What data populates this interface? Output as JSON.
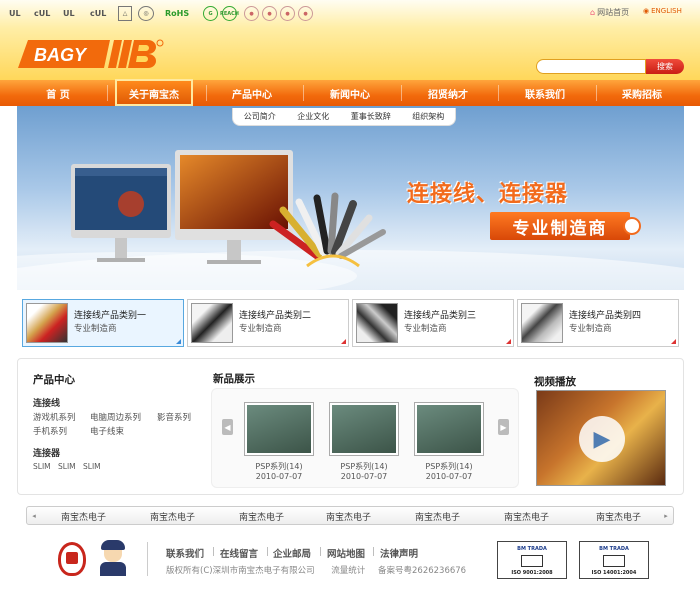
{
  "header": {
    "certifications": [
      "UL",
      "cUL",
      "UL",
      "cUL",
      "RoHS",
      "CE",
      "CCC",
      "REACH"
    ],
    "homepage_link": "网站首页",
    "english_link": "ENGLISH",
    "logo_text": "BAGY",
    "search_button": "搜索",
    "search_placeholder": ""
  },
  "nav": {
    "items": [
      "首 页",
      "关于南宝杰",
      "产品中心",
      "新闻中心",
      "招贤纳才",
      "联系我们",
      "采购招标"
    ],
    "active": "关于南宝杰",
    "subnav": [
      "公司简介",
      "企业文化",
      "董事长致辞",
      "组织架构"
    ]
  },
  "banner": {
    "title": "连接线、连接器",
    "badge": "专业制造商"
  },
  "categories": [
    {
      "title": "连接线产品类别一",
      "sub": "专业制造商"
    },
    {
      "title": "连接线产品类别二",
      "sub": "专业制造商"
    },
    {
      "title": "连接线产品类别三",
      "sub": "专业制造商"
    },
    {
      "title": "连接线产品类别四",
      "sub": "专业制造商"
    }
  ],
  "product_center": {
    "heading": "产品中心",
    "group1": "连接线",
    "links1": [
      "游戏机系列",
      "电脑周边系列",
      "影音系列",
      "手机系列",
      "电子线束"
    ],
    "group2": "连接器",
    "links2": [
      "SLIM",
      "SLIM",
      "SLIM"
    ]
  },
  "new_products": {
    "heading": "新品展示",
    "items": [
      {
        "name": "PSP系列(14)",
        "date": "2010-07-07"
      },
      {
        "name": "PSP系列(14)",
        "date": "2010-07-07"
      },
      {
        "name": "PSP系列(14)",
        "date": "2010-07-07"
      }
    ]
  },
  "video": {
    "heading": "视频播放"
  },
  "partners": [
    "南宝杰电子",
    "南宝杰电子",
    "南宝杰电子",
    "南宝杰电子",
    "南宝杰电子",
    "南宝杰电子",
    "南宝杰电子"
  ],
  "footer": {
    "links": [
      "联系我们",
      "在线留言",
      "企业邮局",
      "网站地图",
      "法律声明"
    ],
    "copyright": "版权所有(C)深圳市南宝杰电子有限公司",
    "stats": "流量统计",
    "icp": "备案号粤2626236676",
    "certs": [
      "ISO 9001:2008",
      "ISO 14001:2004"
    ],
    "cert_brand": "BM TRADA"
  },
  "colors": {
    "nav_orange": "#f26a0c",
    "header_yellow": "#ffd75a",
    "search_red": "#d8281c",
    "banner_orange": "#f26b1d"
  }
}
